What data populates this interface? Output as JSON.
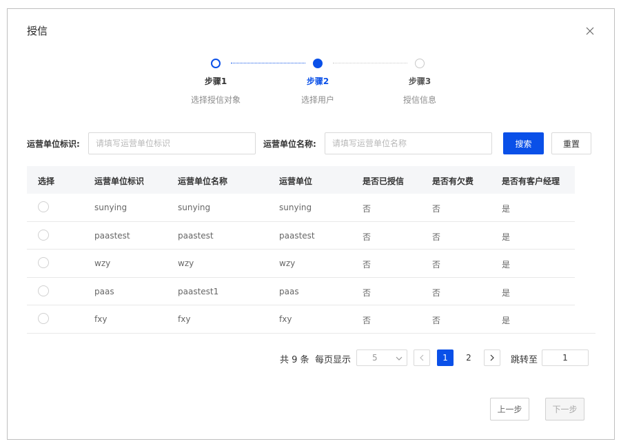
{
  "dialog": {
    "title": "授信",
    "close_icon": "close-icon"
  },
  "steps": [
    {
      "title": "步骤1",
      "desc": "选择授信对象",
      "status": "done"
    },
    {
      "title": "步骤2",
      "desc": "选择用户",
      "status": "active"
    },
    {
      "title": "步骤3",
      "desc": "授信信息",
      "status": "wait"
    }
  ],
  "search": {
    "id_label": "运营单位标识:",
    "id_placeholder": "请填写运营单位标识",
    "id_value": "",
    "name_label": "运营单位名称:",
    "name_placeholder": "请填写运营单位名称",
    "name_value": "",
    "search_button": "搜索",
    "reset_button": "重置"
  },
  "table": {
    "columns": [
      "选择",
      "运营单位标识",
      "运营单位名称",
      "运营单位",
      "是否已授信",
      "是否有欠费",
      "是否有客户经理"
    ],
    "rows": [
      {
        "id": "sunying",
        "name": "sunying",
        "unit": "sunying",
        "credited": "否",
        "arrears": "否",
        "manager": "是"
      },
      {
        "id": "paastest",
        "name": "paastest",
        "unit": "paastest",
        "credited": "否",
        "arrears": "否",
        "manager": "是"
      },
      {
        "id": "wzy",
        "name": "wzy",
        "unit": "wzy",
        "credited": "否",
        "arrears": "否",
        "manager": "是"
      },
      {
        "id": "paas",
        "name": "paastest1",
        "unit": "paas",
        "credited": "否",
        "arrears": "否",
        "manager": "是"
      },
      {
        "id": "fxy",
        "name": "fxy",
        "unit": "fxy",
        "credited": "否",
        "arrears": "否",
        "manager": "是"
      }
    ]
  },
  "pagination": {
    "total_text": "共 9 条",
    "page_size_label": "每页显示",
    "page_size": "5",
    "pages": [
      "1",
      "2"
    ],
    "current_page": "1",
    "jump_label": "跳转至",
    "jump_value": "1"
  },
  "footer": {
    "prev_button": "上一步",
    "next_button": "下一步"
  },
  "colors": {
    "primary": "#0a50e8",
    "border": "#d9d9d9",
    "header_bg": "#f5f6f8"
  }
}
